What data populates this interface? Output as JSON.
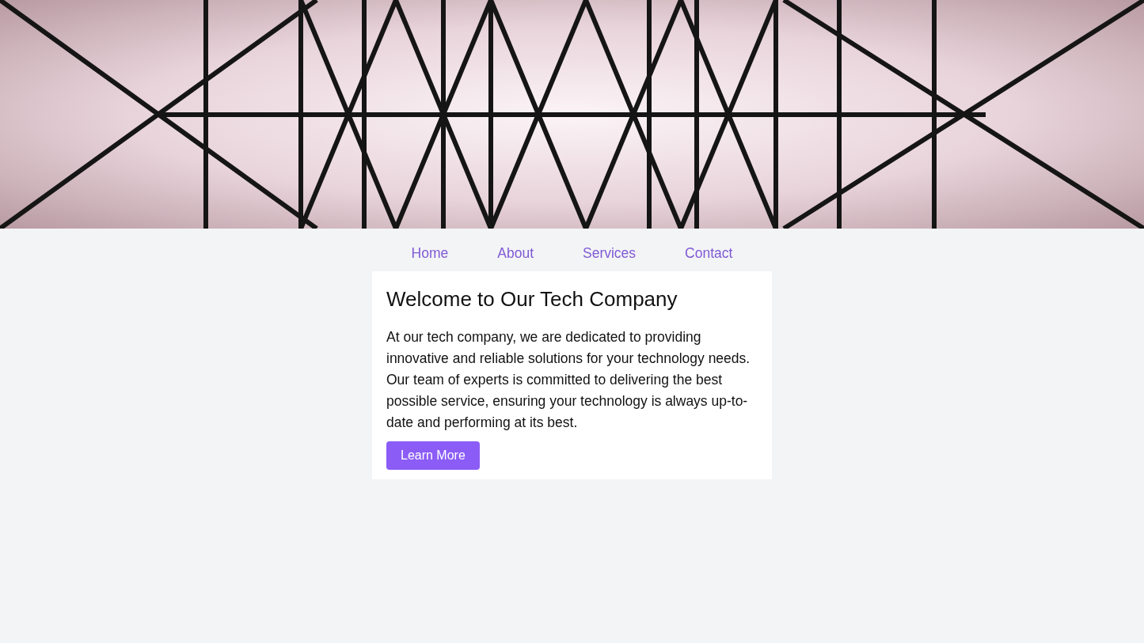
{
  "hero": {
    "kind": "photo"
  },
  "nav": {
    "links": [
      {
        "label": "Home"
      },
      {
        "label": "About"
      },
      {
        "label": "Services"
      },
      {
        "label": "Contact"
      }
    ]
  },
  "card": {
    "title": "Welcome to Our Tech Company",
    "body": "At our tech company, we are dedicated to providing innovative and reliable solutions for your technology needs. Our team of experts is committed to delivering the best possible service, ensuring your technology is always up-to-date and performing at its best.",
    "button": "Learn More"
  }
}
